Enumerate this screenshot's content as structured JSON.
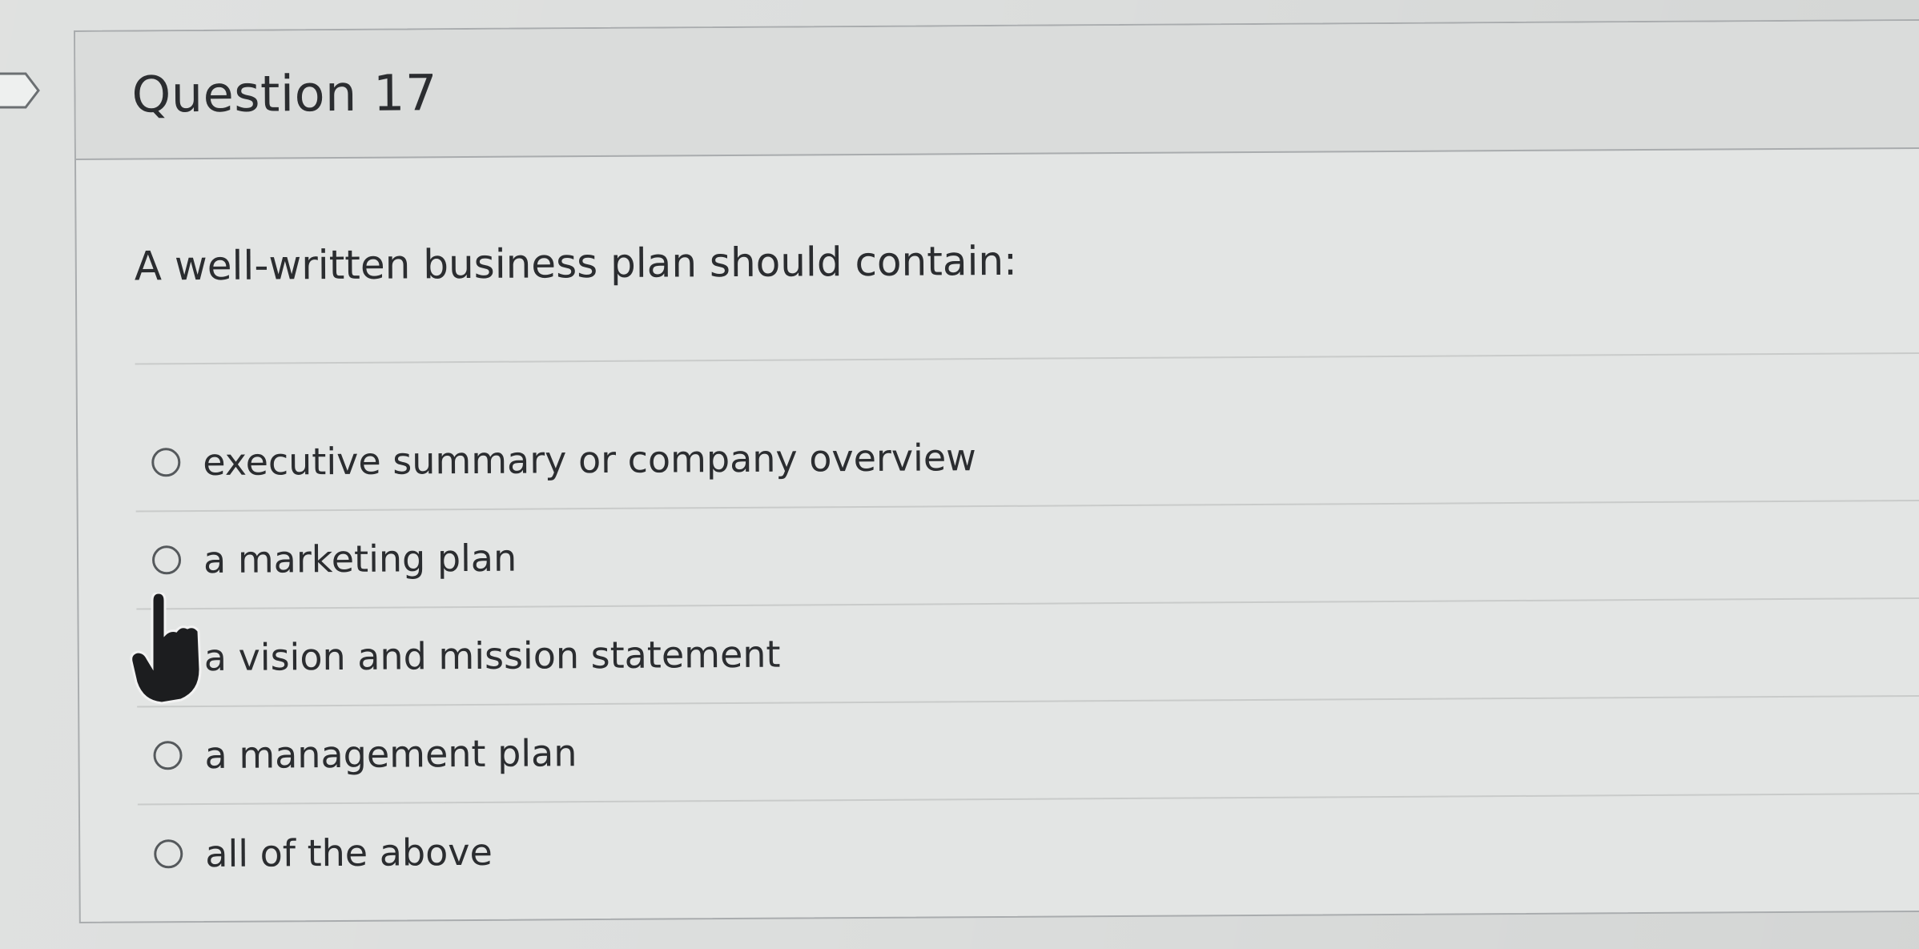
{
  "question": {
    "title": "Question 17",
    "prompt": "A well-written business plan should contain:"
  },
  "options": [
    {
      "label": "executive summary or company overview",
      "selected": false
    },
    {
      "label": "a marketing plan",
      "selected": false
    },
    {
      "label": "a vision and mission statement",
      "selected": false
    },
    {
      "label": "a management plan",
      "selected": false
    },
    {
      "label": "all of the above",
      "selected": false
    }
  ],
  "icons": {
    "bookmark": "bookmark-flag-icon",
    "cursor": "hand-pointer-icon"
  },
  "colors": {
    "card_border": "#a9acae",
    "text": "#2b2d30",
    "radio_border": "#55595c"
  }
}
